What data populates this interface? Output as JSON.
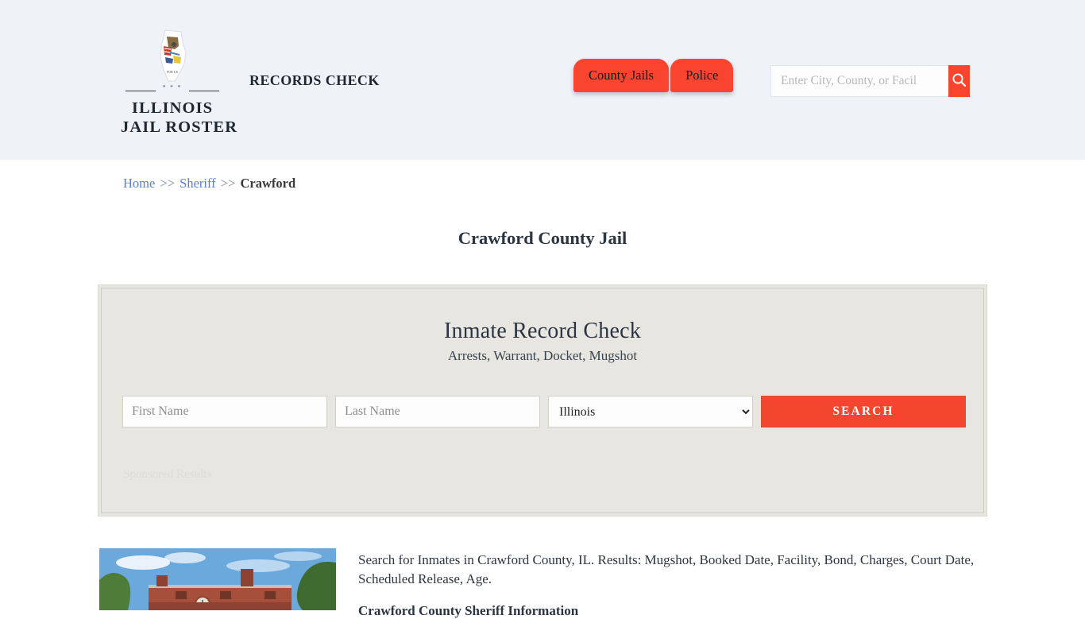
{
  "header": {
    "brand": {
      "logo_icon": "illinois-state-outline-seal",
      "line1": "ILLINOIS",
      "line2": "JAIL ROSTER",
      "rule_ornament": "* * *"
    },
    "tagline": "RECORDS CHECK",
    "nav": [
      {
        "label": "County Jails"
      },
      {
        "label": "Police"
      }
    ],
    "search": {
      "placeholder": "Enter City, County, or Facil",
      "value": "",
      "button_icon": "search-icon"
    }
  },
  "breadcrumb": {
    "items": [
      {
        "label": "Home",
        "type": "link"
      },
      {
        "label": "Sheriff",
        "type": "link"
      },
      {
        "label": "Crawford",
        "type": "current"
      }
    ],
    "separator": ">>"
  },
  "page_title": "Crawford County Jail",
  "record_card": {
    "title": "Inmate Record Check",
    "subtitle": "Arrests, Warrant, Docket, Mugshot",
    "first_name": {
      "placeholder": "First Name",
      "value": ""
    },
    "last_name": {
      "placeholder": "Last Name",
      "value": ""
    },
    "state": {
      "selected": "Illinois",
      "options": [
        "Illinois"
      ]
    },
    "search_button": "SEARCH",
    "sponsored_label": "Sponsored Results"
  },
  "content": {
    "image_alt": "Crawford County brick courthouse building",
    "paragraph": "Search for Inmates in Crawford County, IL. Results: Mugshot, Booked Date, Facility, Bond, Charges, Court Date, Scheduled Release, Age.",
    "subheading": "Crawford County Sheriff Information"
  },
  "colors": {
    "header_bg": "#eff3f8",
    "accent_red": "#f9442f",
    "button_red": "#f4452f",
    "card_bg": "#e8e6e1",
    "link_blue": "#5a7fd0",
    "text_dark": "#2b3442"
  }
}
